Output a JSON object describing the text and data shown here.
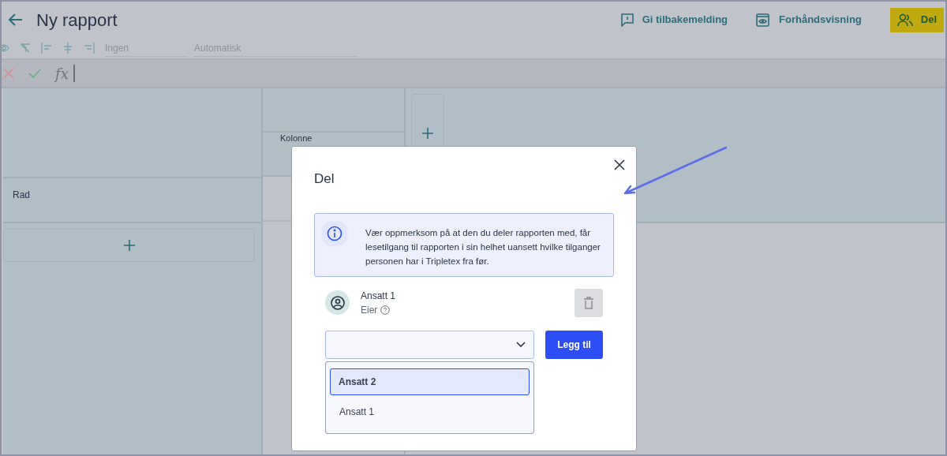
{
  "header": {
    "title": "Ny rapport",
    "actions": [
      {
        "kind": "feedback",
        "label": "Gi tilbakemelding"
      },
      {
        "kind": "preview",
        "label": "Forhåndsvisning"
      },
      {
        "kind": "share",
        "label": "Del"
      }
    ]
  },
  "toolbar": {
    "fields": [
      {
        "placeholder": "Ingen"
      },
      {
        "placeholder": "Automatisk"
      }
    ]
  },
  "formula_bar": {
    "function_label": "fx"
  },
  "pivot": {
    "row_label": "Rad",
    "column_label": "Kolonne"
  },
  "dialog": {
    "title": "Del",
    "notice": "Vær oppmerksom på at den du deler rapporten med, får lesetilgang til rapporten i sin helhet uansett hvilke tilganger personen har i Tripletex fra før.",
    "members": [
      {
        "name": "Ansatt 1",
        "role": "Eier"
      }
    ],
    "select": {
      "options": [
        {
          "label": "Ansatt 2",
          "selected": true
        },
        {
          "label": "Ansatt 1",
          "selected": false
        }
      ]
    },
    "add_button": "Legg til"
  }
}
